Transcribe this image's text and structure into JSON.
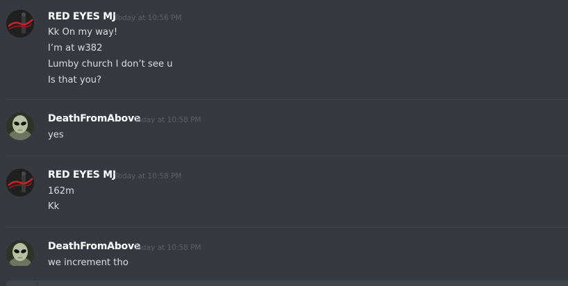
{
  "messages": [
    {
      "author": "RED EYES MJ",
      "timestamp": "Today at 10:56 PM",
      "avatar_icon": "red-eyes-thriller-avatar-icon",
      "lines": [
        "Kk On my way!",
        "I’m at w382",
        "Lumby church I don’t see u",
        "Is that you?"
      ]
    },
    {
      "author": "DeathFromAbove",
      "timestamp": "Today at 10:58 PM",
      "avatar_icon": "alien-avatar-icon",
      "lines": [
        "yes"
      ]
    },
    {
      "author": "RED EYES MJ",
      "timestamp": "Today at 10:58 PM",
      "avatar_icon": "red-eyes-thriller-avatar-icon",
      "lines": [
        "162m",
        "Kk"
      ]
    },
    {
      "author": "DeathFromAbove",
      "timestamp": "Today at 10:58 PM",
      "avatar_icon": "alien-avatar-icon",
      "lines": [
        "we increment tho"
      ]
    }
  ],
  "colors": {
    "background": "#36393f",
    "author": "#ffffff",
    "message_text": "#dcddde",
    "timestamp": "#5e6166",
    "divider": "#42454a",
    "input_background": "#40444b"
  }
}
